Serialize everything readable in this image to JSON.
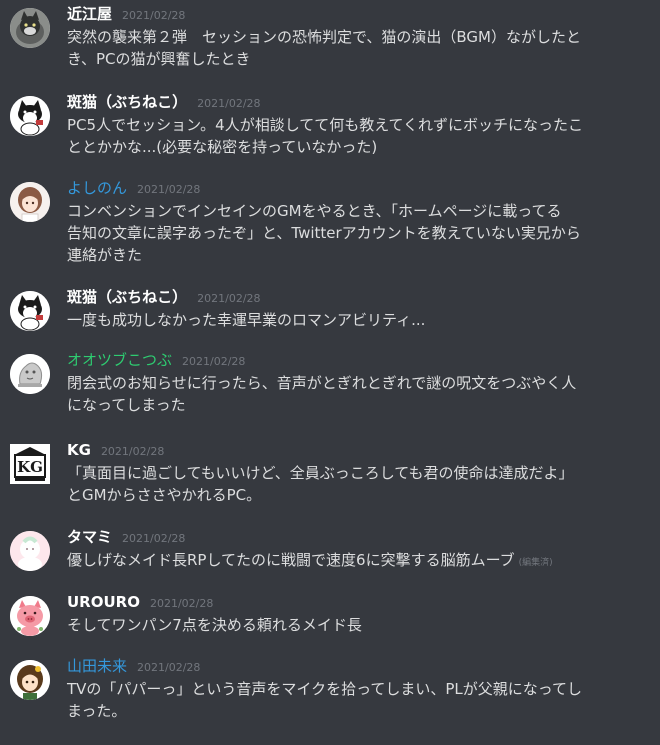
{
  "messages": [
    {
      "author": "近江屋",
      "author_color": "#ffffff",
      "timestamp": "2021/02/28",
      "text": "突然の襲来第２弾　セッションの恐怖判定で、猫の演出（BGM）ながしたと\nき、PCの猫が興奮したとき",
      "edited": ""
    },
    {
      "author": "斑猫（ぶちねこ）",
      "author_color": "#ffffff",
      "timestamp": "2021/02/28",
      "text": "PC5人でセッション。4人が相談してて何も教えてくれずにボッチになったこ\nととかかな...(必要な秘密を持っていなかった)",
      "edited": ""
    },
    {
      "author": "よしのん",
      "author_color": "#3498db",
      "timestamp": "2021/02/28",
      "text": "コンベンションでインセインのGMをやるとき、「ホームページに載ってる\n告知の文章に誤字あったぞ」と、Twitterアカウントを教えていない実兄から\n連絡がきた",
      "edited": ""
    },
    {
      "author": "斑猫（ぶちねこ）",
      "author_color": "#ffffff",
      "timestamp": "2021/02/28",
      "text": "一度も成功しなかった幸運早業のロマンアビリティ...",
      "edited": ""
    },
    {
      "author": "オオツブこつぶ",
      "author_color": "#2ecc71",
      "timestamp": "2021/02/28",
      "text": "閉会式のお知らせに行ったら、音声がとぎれとぎれで謎の呪文をつぶやく人\nになってしまった",
      "edited": ""
    },
    {
      "author": "KG",
      "author_color": "#ffffff",
      "timestamp": "2021/02/28",
      "text": "「真面目に過ごしてもいいけど、全員ぶっころしても君の使命は達成だよ」\nとGMからささやかれるPC。",
      "edited": ""
    },
    {
      "author": "タマミ",
      "author_color": "#ffffff",
      "timestamp": "2021/02/28",
      "text": "優しげなメイド長RPしてたのに戦闘で速度6に突撃する脳筋ムーブ",
      "edited": "(編集済)"
    },
    {
      "author": "UROURO",
      "author_color": "#ffffff",
      "timestamp": "2021/02/28",
      "text": "そしてワンパン7点を決める頼れるメイド長",
      "edited": ""
    },
    {
      "author": "山田未来",
      "author_color": "#3498db",
      "timestamp": "2021/02/28",
      "text": "TVの「パパーっ」という音声をマイクを拾ってしまい、PLが父親になってし\nまった。",
      "edited": ""
    }
  ],
  "avatars": [
    {
      "icon": "cat-photo-avatar"
    },
    {
      "icon": "black-white-cat-avatar"
    },
    {
      "icon": "anime-girl-avatar"
    },
    {
      "icon": "black-white-cat-avatar"
    },
    {
      "icon": "grey-sketch-avatar"
    },
    {
      "icon": "kg-logo-avatar",
      "logo_text": "KG"
    },
    {
      "icon": "pastel-character-avatar"
    },
    {
      "icon": "pink-pig-avatar"
    },
    {
      "icon": "brown-hair-girl-avatar"
    }
  ],
  "colors": {
    "background": "#36393f",
    "text": "#dcddde",
    "timestamp": "#72767d",
    "name_default": "#ffffff",
    "name_blue": "#3498db",
    "name_green": "#2ecc71"
  }
}
